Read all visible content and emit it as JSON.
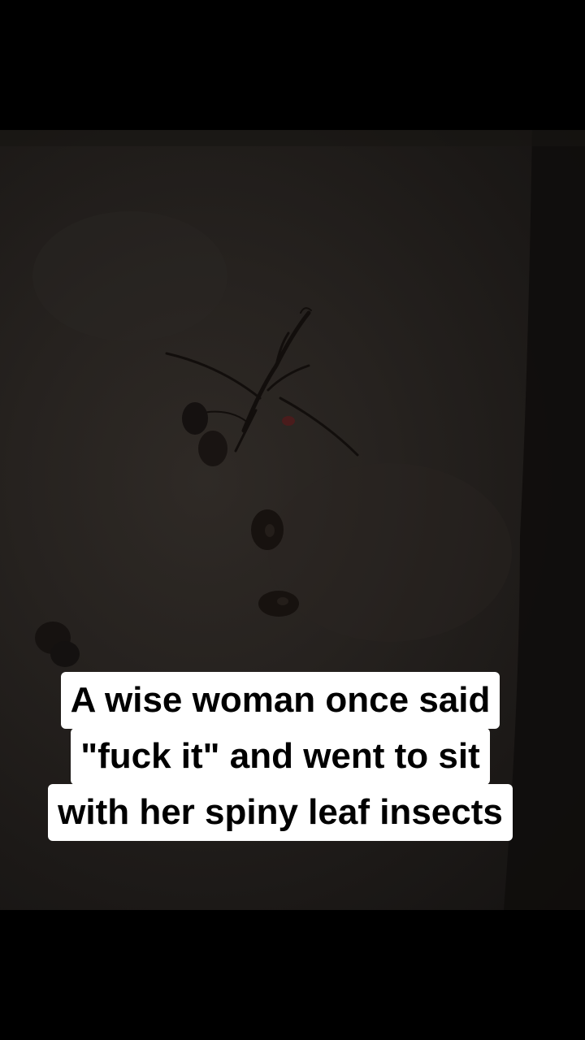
{
  "caption": {
    "lines": [
      "A wise woman once said",
      "\"fuck it\" and went to sit",
      "with her spiny leaf insects"
    ]
  },
  "photo": {
    "subject": "spiny-leaf-insect",
    "background_color": "#26221f",
    "insect_color": "#120e0c"
  }
}
